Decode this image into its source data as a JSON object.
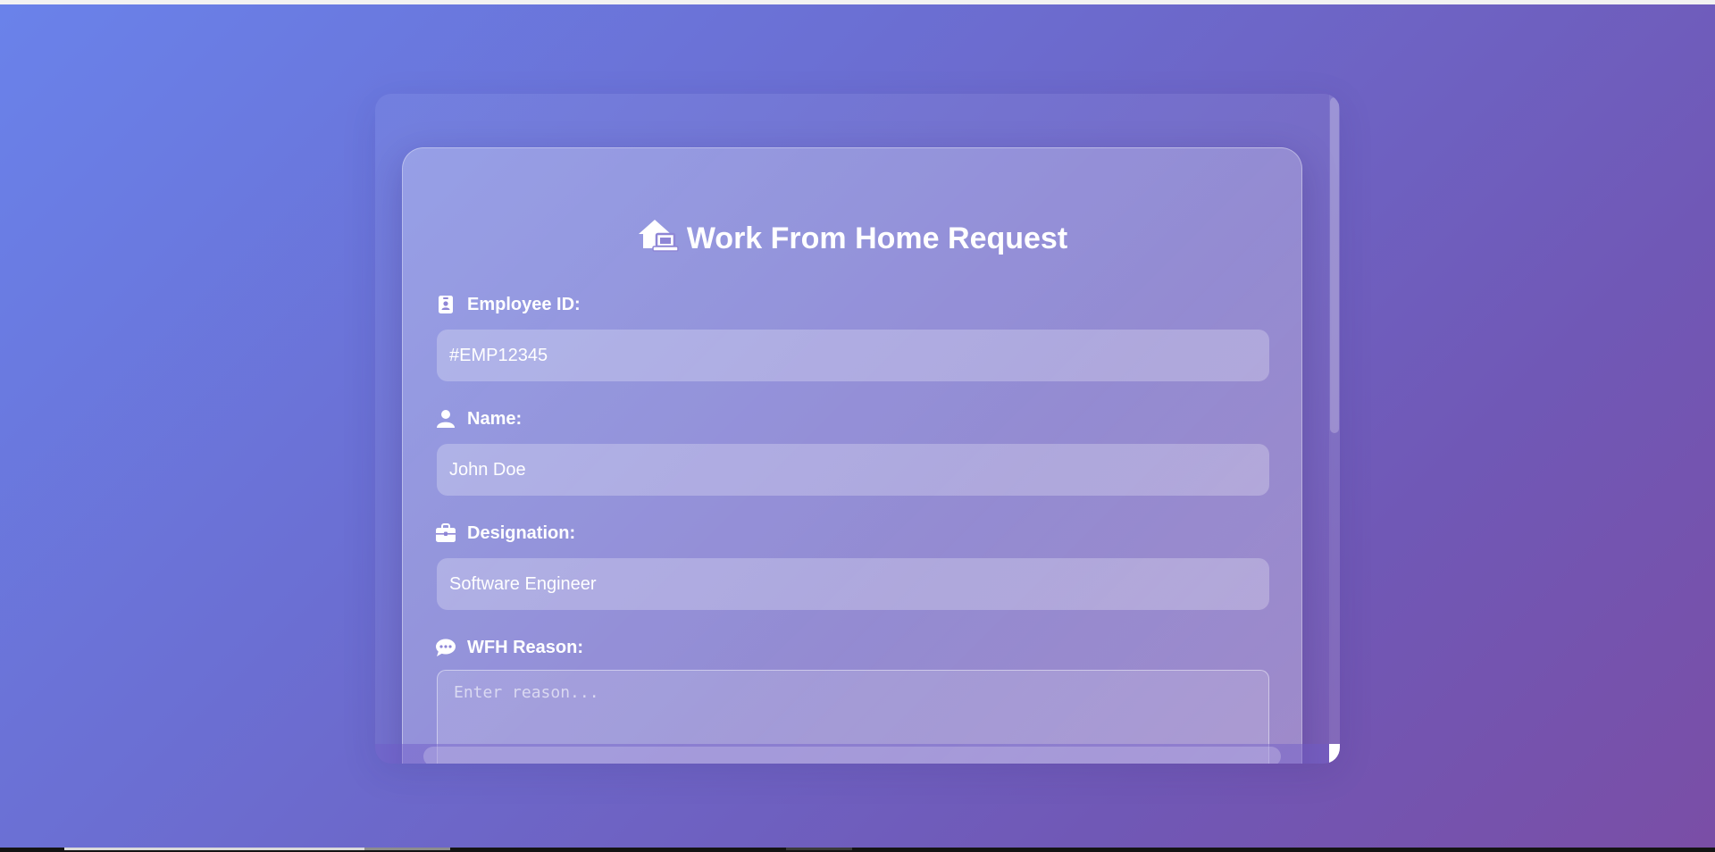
{
  "form": {
    "title": "Work From Home Request",
    "title_icon": "house-laptop-icon",
    "fields": [
      {
        "label": "Employee ID:",
        "icon": "id-card-icon",
        "value": "#EMP12345"
      },
      {
        "label": "Name:",
        "icon": "user-icon",
        "value": "John Doe"
      },
      {
        "label": "Designation:",
        "icon": "briefcase-icon",
        "value": "Software Engineer"
      }
    ],
    "reason": {
      "label": "WFH Reason:",
      "icon": "comment-icon",
      "placeholder": "Enter reason..."
    }
  },
  "colors": {
    "gradient_start": "#6a82ea",
    "gradient_end": "#7a4ea6",
    "text": "#ffffff"
  }
}
